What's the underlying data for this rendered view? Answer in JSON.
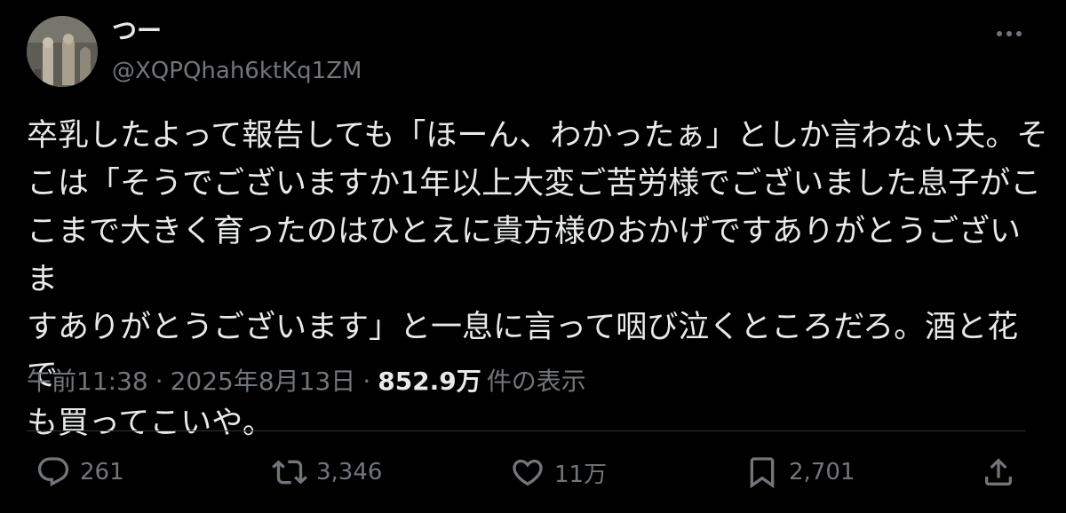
{
  "author": {
    "display_name": "つー",
    "handle": "@XQPQhah6ktKq1ZM"
  },
  "tweet": {
    "text": "卒乳したよって報告しても「ほーん、わかったぁ」としか言わない夫。そ\nこは「そうでございますか1年以上大変ご苦労様でございました息子がこ\nこまで大きく育ったのはひとえに貴方様のおかげですありがとうございま\nすありがとうございます」と一息に言って咽び泣くところだろ。酒と花で\nも買ってこいや。",
    "time": "午前11:38",
    "separator": "·",
    "date": "2025年8月13日",
    "views_count": "852.9万",
    "views_label": "件の表示"
  },
  "actions": {
    "reply_count": "261",
    "retweet_count": "3,346",
    "like_count": "11万",
    "bookmark_count": "2,701"
  },
  "icons": {
    "more": "more-dots-icon",
    "reply": "reply-bubble-icon",
    "retweet": "retweet-icon",
    "like": "heart-icon",
    "bookmark": "bookmark-icon",
    "share": "share-upload-icon"
  },
  "colors": {
    "background": "#000000",
    "text_primary": "#e7e9ea",
    "text_secondary": "#71767b",
    "divider": "#2f3336"
  }
}
